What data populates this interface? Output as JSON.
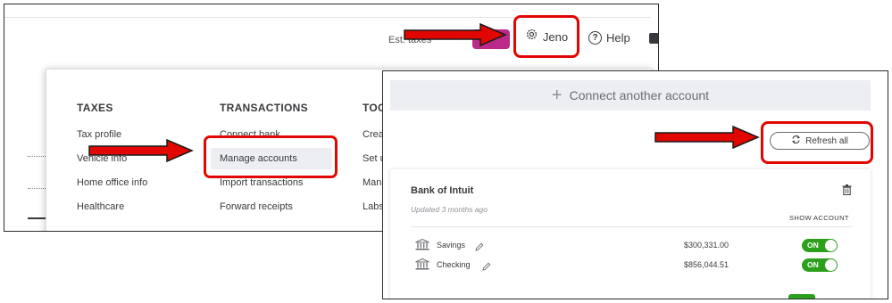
{
  "header": {
    "est_text": "Est. taxes",
    "user_name": "Jeno",
    "help_label": "Help"
  },
  "menu": {
    "taxes": {
      "heading": "TAXES",
      "items": [
        "Tax profile",
        "Vehicle info",
        "Home office info",
        "Healthcare"
      ]
    },
    "transactions": {
      "heading": "TRANSACTIONS",
      "items": [
        "Connect bank",
        "Manage accounts",
        "Import transactions",
        "Forward receipts"
      ]
    },
    "tools": {
      "heading": "TOO",
      "items": [
        "Crea",
        "Set u",
        "Mana",
        "Labs"
      ]
    }
  },
  "accounts_panel": {
    "connect_label": "Connect another account",
    "refresh_label": "Refresh all",
    "bank_name": "Bank of Intuit",
    "updated_text": "Updated 3 months ago",
    "show_account_label": "SHOW ACCOUNT",
    "accounts": [
      {
        "name": "Savings",
        "amount": "$300,331.00",
        "toggle": "ON"
      },
      {
        "name": "Checking",
        "amount": "$856,044.51",
        "toggle": "ON"
      }
    ]
  },
  "colors": {
    "highlight_red": "#e10600",
    "toggle_green": "#2ca01c",
    "est_button": "#bb2a88"
  },
  "icons": [
    "gear-icon",
    "help-icon",
    "chat-icon",
    "plus-icon",
    "refresh-icon",
    "trash-icon",
    "bank-icon",
    "pencil-icon",
    "arrow-icon"
  ]
}
